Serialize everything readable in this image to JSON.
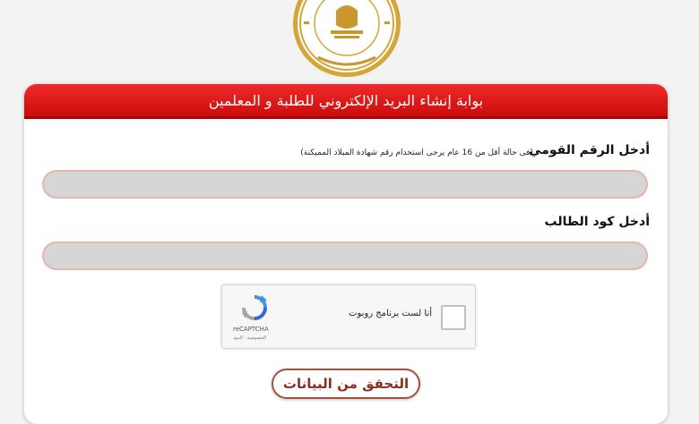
{
  "header": {
    "title": "بوابة إنشاء البريد الإلكتروني للطلبة و المعلمين"
  },
  "form": {
    "national_id": {
      "label": "أدخل الرقم القومي",
      "hint": "(فى حالة أقل من 16 عام يرجى استخدام رقم شهادة الميلاد المميكنة)",
      "value": ""
    },
    "student_code": {
      "label": "أدخل كود الطالب",
      "value": ""
    },
    "recaptcha": {
      "checkbox_label": "أنا لست برنامج روبوت",
      "brand": "reCAPTCHA",
      "terms": "الخصوصية - البنود"
    },
    "submit_label": "التحقق من البيانات"
  },
  "colors": {
    "header_red": "#e01a1a",
    "input_bg": "#d6d6d6",
    "input_border": "#e7b4b0",
    "button_border": "#a6503d",
    "button_text": "#8b2f1f"
  },
  "icons": {
    "logo": "ministry-seal-icon",
    "captcha": "recaptcha-icon"
  }
}
